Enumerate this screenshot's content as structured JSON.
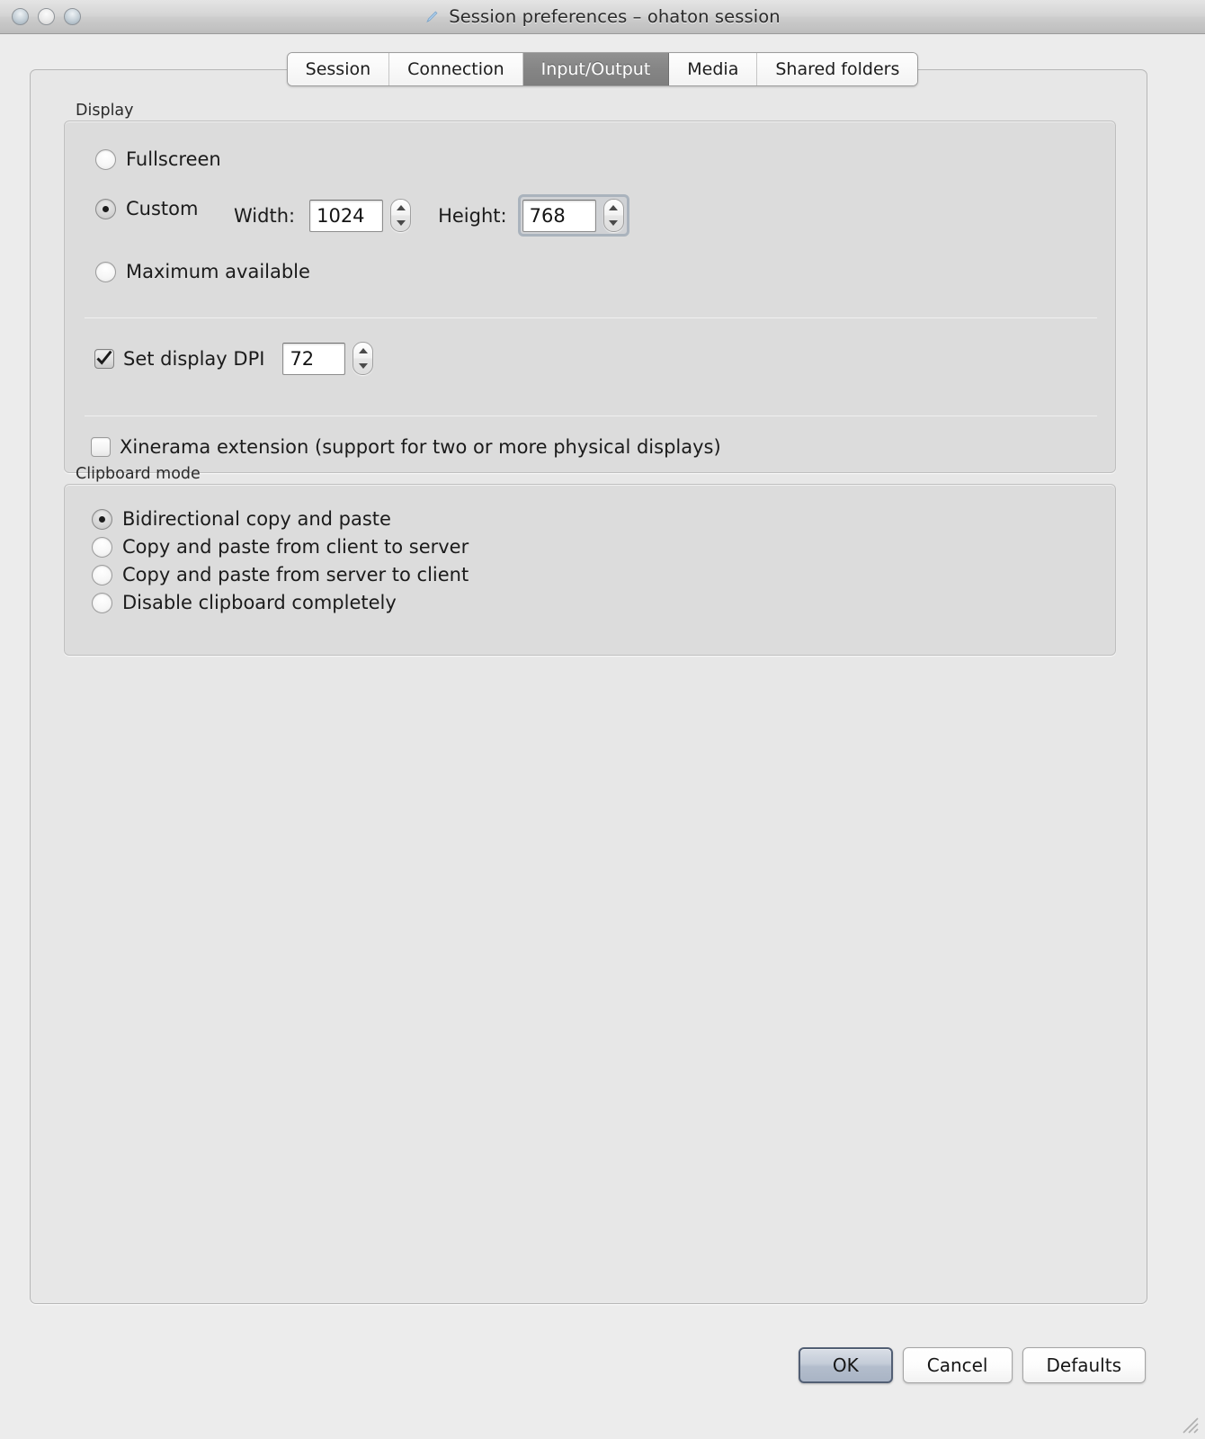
{
  "window": {
    "title": "Session preferences – ohaton session",
    "title_icon": "pencil-icon",
    "controls": [
      "close-button",
      "minimize-button",
      "zoom-button"
    ],
    "resize_grip": "resize-grip"
  },
  "tabs": [
    {
      "label": "Session",
      "active": false
    },
    {
      "label": "Connection",
      "active": false
    },
    {
      "label": "Input/Output",
      "active": true
    },
    {
      "label": "Media",
      "active": false
    },
    {
      "label": "Shared folders",
      "active": false
    }
  ],
  "display": {
    "group_label": "Display",
    "mode_options": [
      {
        "label": "Fullscreen",
        "selected": false
      },
      {
        "label": "Custom",
        "selected": true
      },
      {
        "label": "Maximum available",
        "selected": false
      }
    ],
    "width": {
      "label": "Width:",
      "value": "1024",
      "focused": false
    },
    "height": {
      "label": "Height:",
      "value": "768",
      "focused": true
    },
    "dpi": {
      "label": "Set display DPI",
      "checked": true,
      "value": "72"
    },
    "xinerama": {
      "label": "Xinerama extension (support for two or more physical displays)",
      "checked": false
    }
  },
  "clipboard": {
    "group_label": "Clipboard mode",
    "options": [
      {
        "label": "Bidirectional copy and paste",
        "selected": true
      },
      {
        "label": "Copy and paste from client to server",
        "selected": false
      },
      {
        "label": "Copy and paste from server to client",
        "selected": false
      },
      {
        "label": "Disable clipboard completely",
        "selected": false
      }
    ]
  },
  "footer": {
    "ok_label": "OK",
    "cancel_label": "Cancel",
    "defaults_label": "Defaults"
  },
  "colors": {
    "window_bg": "#ececec",
    "panel_bg": "#e7e7e7",
    "group_bg": "#dcdcdc",
    "active_tab_bg": "#858585",
    "default_button_border": "#525f74",
    "focus_ring": "#aab3bd",
    "pencil_icon": "#9dc4e8"
  }
}
